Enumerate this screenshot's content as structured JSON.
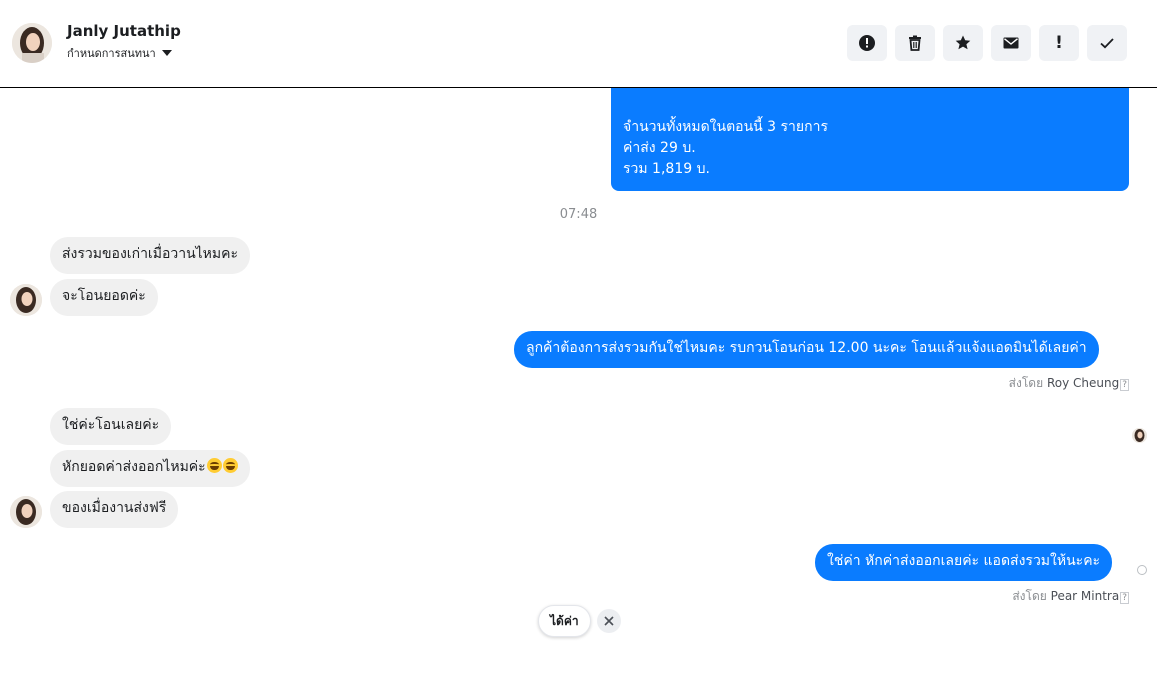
{
  "header": {
    "contact_name": "Janly Jutathip",
    "conversation_menu": "กำหนดการสนทนา",
    "actions": [
      {
        "icon": "alert-circle-icon"
      },
      {
        "icon": "trash-icon"
      },
      {
        "icon": "star-icon"
      },
      {
        "icon": "mail-icon"
      },
      {
        "icon": "exclamation-icon",
        "label": "!"
      },
      {
        "icon": "check-icon"
      }
    ]
  },
  "messages": {
    "order_summary": {
      "line1": "จำนวนทั้งหมดในตอนนี้ 3 รายการ",
      "line2": "ค่าส่ง 29 บ.",
      "line3": "รวม 1,819 บ."
    },
    "timestamp": "07:48",
    "incoming_1": "ส่งรวมของเก่าเมื่อวานไหมคะ",
    "incoming_2": "จะโอนยอดค่ะ",
    "outgoing_1": "ลูกค้าต้องการส่งรวมกันใช่ไหมคะ รบกวนโอนก่อน 12.00 นะคะ โอนแล้วแจ้งแอดมินได้เลยค่า",
    "sent_by_1_prefix": "ส่งโดย",
    "sent_by_1_name": "Roy Cheung",
    "incoming_3": "ใช่ค่ะโอนเลยค่ะ",
    "incoming_4": "หักยอดค่าส่งออกไหมค่ะ",
    "incoming_5": "ของเมื่องานส่งฟรี",
    "outgoing_2": "ใช่ค่า หักค่าส่งออกเลยค่ะ แอดส่งรวมให้นะคะ",
    "sent_by_2_prefix": "ส่งโดย",
    "sent_by_2_name": "Pear Mintra",
    "help_marker": "?"
  },
  "quick_reply": {
    "label": "ได้ค่า"
  },
  "colors": {
    "outgoing_bubble": "#0a7cff",
    "incoming_bubble": "#f0f0f0",
    "action_button_bg": "#f0f2f5"
  }
}
